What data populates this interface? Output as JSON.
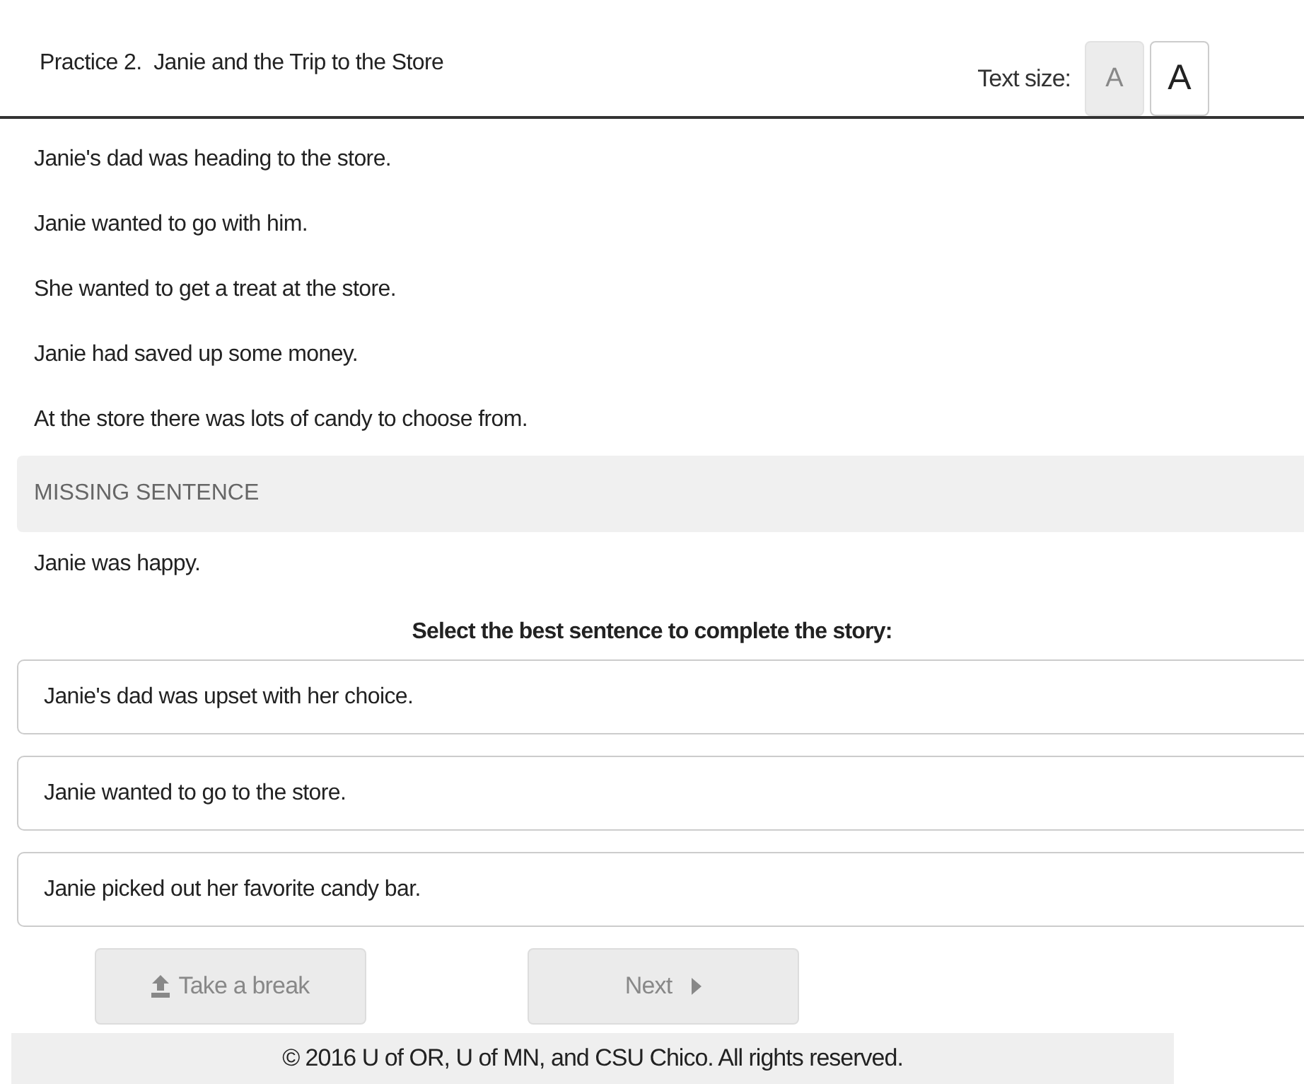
{
  "header": {
    "title": "Practice 2.  Janie and the Trip to the Store",
    "text_size_label": "Text size:",
    "text_sizes": [
      {
        "label": "A",
        "kind": "small",
        "selected": true
      },
      {
        "label": "A",
        "kind": "large",
        "selected": false
      }
    ]
  },
  "story": [
    {
      "kind": "sentence",
      "text": "Janie's dad was heading to the store."
    },
    {
      "kind": "sentence",
      "text": "Janie wanted to go with him."
    },
    {
      "kind": "sentence",
      "text": "She wanted to get a treat at the store."
    },
    {
      "kind": "sentence",
      "text": "Janie had saved up some money."
    },
    {
      "kind": "sentence",
      "text": "At the store there was lots of candy to choose from."
    },
    {
      "kind": "missing",
      "text": "MISSING SENTENCE"
    },
    {
      "kind": "sentence",
      "text": "Janie was happy."
    }
  ],
  "prompt": "Select the best sentence to complete the story:",
  "options": [
    {
      "text": "Janie's dad was upset with her choice.",
      "selected": false
    },
    {
      "text": "Janie wanted to go to the store.",
      "selected": false
    },
    {
      "text": "Janie picked out her favorite candy bar.",
      "selected": false
    }
  ],
  "buttons": [
    {
      "label": "Take a break",
      "kind": "break",
      "disabled": true
    },
    {
      "label": "Next",
      "kind": "next",
      "disabled": true
    }
  ],
  "footer": "© 2016 U of OR, U of MN, and CSU Chico. All rights reserved."
}
